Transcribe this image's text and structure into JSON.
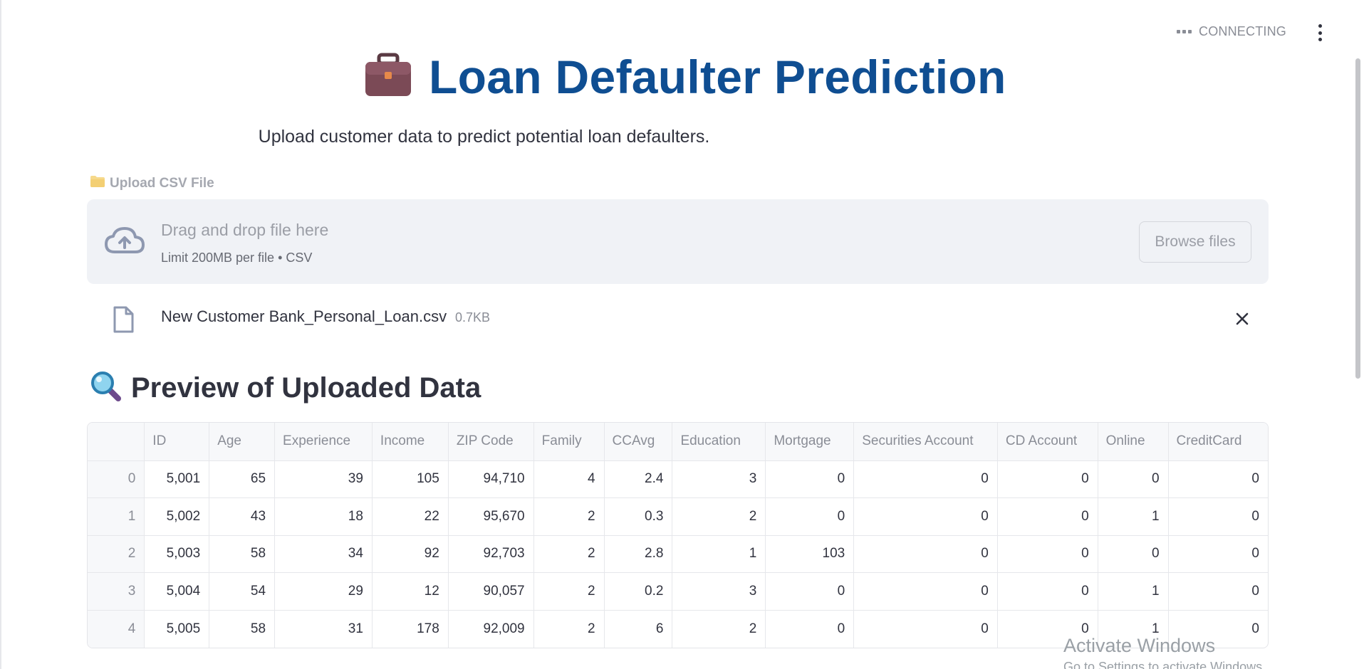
{
  "status": {
    "text": "CONNECTING"
  },
  "header": {
    "title": "Loan Defaulter Prediction",
    "subtitle": "Upload customer data to predict potential loan defaulters."
  },
  "uploader": {
    "label": "Upload CSV File",
    "drop_title": "Drag and drop file here",
    "drop_limit": "Limit 200MB per file • CSV",
    "browse_label": "Browse files"
  },
  "file": {
    "name": "New Customer Bank_Personal_Loan.csv",
    "size": "0.7KB"
  },
  "preview": {
    "title": "Preview of Uploaded Data",
    "columns": [
      "",
      "ID",
      "Age",
      "Experience",
      "Income",
      "ZIP Code",
      "Family",
      "CCAvg",
      "Education",
      "Mortgage",
      "Securities Account",
      "CD Account",
      "Online",
      "CreditCard"
    ],
    "rows": [
      [
        "0",
        "5,001",
        "65",
        "39",
        "105",
        "94,710",
        "4",
        "2.4",
        "3",
        "0",
        "0",
        "0",
        "0",
        "0"
      ],
      [
        "1",
        "5,002",
        "43",
        "18",
        "22",
        "95,670",
        "2",
        "0.3",
        "2",
        "0",
        "0",
        "0",
        "1",
        "0"
      ],
      [
        "2",
        "5,003",
        "58",
        "34",
        "92",
        "92,703",
        "2",
        "2.8",
        "1",
        "103",
        "0",
        "0",
        "0",
        "0"
      ],
      [
        "3",
        "5,004",
        "54",
        "29",
        "12",
        "90,057",
        "2",
        "0.2",
        "3",
        "0",
        "0",
        "0",
        "1",
        "0"
      ],
      [
        "4",
        "5,005",
        "58",
        "31",
        "178",
        "92,009",
        "2",
        "6",
        "2",
        "0",
        "0",
        "0",
        "1",
        "0"
      ]
    ]
  },
  "watermark": {
    "line1": "Activate Windows",
    "line2": "Go to Settings to activate Windows."
  },
  "icons": {
    "title_icon": "briefcase-icon",
    "label_icon": "folder-icon",
    "preview_icon": "magnifier-icon",
    "cloud_icon": "cloud-upload-icon",
    "file_icon": "file-icon",
    "close_icon": "close-icon"
  },
  "colors": {
    "title": "#0f4e92",
    "dropzone_bg": "#f0f2f6",
    "text": "#31333f"
  }
}
